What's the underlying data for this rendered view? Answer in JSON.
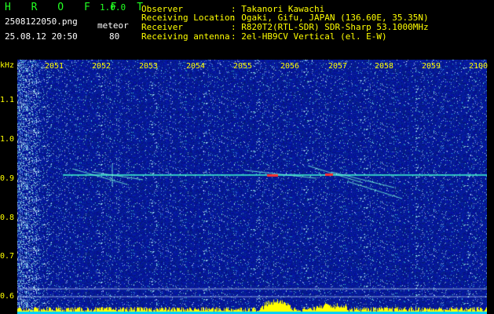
{
  "header": {
    "brand": "H R O F F T",
    "version": "1.0.0",
    "filename": "2508122050.png",
    "datetime": "25.08.12 20:50",
    "mode_label": "meteor",
    "count": "80",
    "info": [
      {
        "key": "Observer",
        "value": ": Takanori Kawachi"
      },
      {
        "key": "Receiving Location",
        "value": ": Ogaki, Gifu, JAPAN (136.60E, 35.35N)"
      },
      {
        "key": "Receiver",
        "value": ": R820T2(RTL-SDR) SDR-Sharp 53.1000MHz"
      },
      {
        "key": "Receiving antenna",
        "value": ": 2el-HB9CV Vertical (el. E-W)"
      }
    ]
  },
  "spectrogram": {
    "y_unit": "kHz",
    "y_ticks": [
      "1.1",
      "1.0",
      "0.9",
      "0.8",
      "0.7",
      "0.6"
    ],
    "x_ticks": [
      "2051",
      "2052",
      "2053",
      "2054",
      "2055",
      "2056",
      "2057",
      "2058",
      "2059",
      "2100"
    ],
    "carrier_khz": 0.91,
    "colors": {
      "background": "#0a1a8c",
      "carrier": "#40ffd0",
      "label": "#ffff00",
      "level": "#ffff00"
    }
  }
}
